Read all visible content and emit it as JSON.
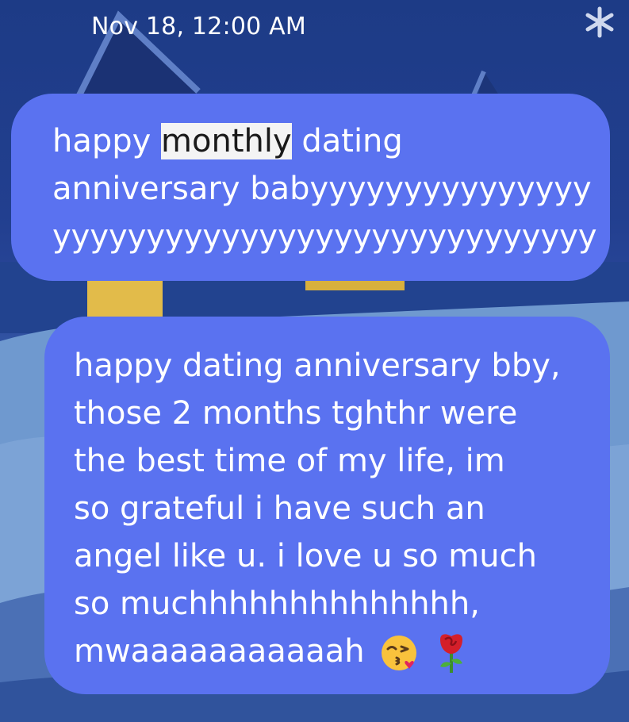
{
  "header": {
    "timestamp": "Nov 18, 12:00 AM",
    "corner_icon": "snowflake-icon"
  },
  "messages": [
    {
      "lines": [
        {
          "before": "happy ",
          "highlight": "monthly",
          "after": " dating"
        },
        {
          "text": "anniversary babyyyyyyyyyyyyyyy"
        },
        {
          "text": "yyyyyyyyyyyyyyyyyyyyyyyyyyyyy"
        }
      ]
    },
    {
      "lines": [
        "happy dating anniversary bby,",
        "those 2 months tghthr were",
        "the best time of my life, im",
        "so grateful i have such an",
        "angel like u. i love u so much",
        "so muchhhhhhhhhhhhhh,",
        "mwaaaaaaaaaaah"
      ],
      "emojis": [
        "kissing-face-icon",
        "rose-icon"
      ]
    }
  ],
  "colors": {
    "bubble": "#5a72f0",
    "highlight": "#f4f4f4",
    "background": "#223f8f"
  }
}
